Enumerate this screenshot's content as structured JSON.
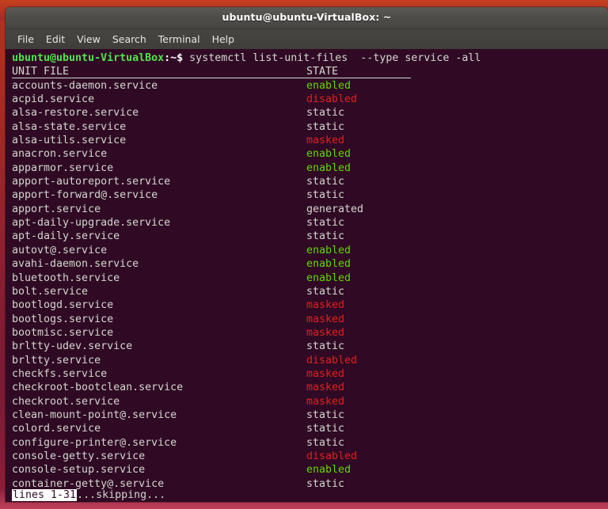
{
  "window": {
    "title": "ubuntu@ubuntu-VirtualBox: ~"
  },
  "menubar": {
    "items": [
      {
        "label": "File",
        "name": "menu-file"
      },
      {
        "label": "Edit",
        "name": "menu-edit"
      },
      {
        "label": "View",
        "name": "menu-view"
      },
      {
        "label": "Search",
        "name": "menu-search"
      },
      {
        "label": "Terminal",
        "name": "menu-terminal"
      },
      {
        "label": "Help",
        "name": "menu-help"
      }
    ]
  },
  "terminal": {
    "prompt_user": "ubuntu@ubuntu-VirtualBox",
    "prompt_tail": ":~$",
    "command": " systemctl list-unit-files  --type service -all",
    "header": {
      "unit_file": "UNIT FILE",
      "state": "STATE"
    },
    "rows": [
      {
        "unit": "accounts-daemon.service",
        "state": "enabled",
        "state_class": "st-enabled"
      },
      {
        "unit": "acpid.service",
        "state": "disabled",
        "state_class": "st-disabled"
      },
      {
        "unit": "alsa-restore.service",
        "state": "static",
        "state_class": "st-static"
      },
      {
        "unit": "alsa-state.service",
        "state": "static",
        "state_class": "st-static"
      },
      {
        "unit": "alsa-utils.service",
        "state": "masked",
        "state_class": "st-masked"
      },
      {
        "unit": "anacron.service",
        "state": "enabled",
        "state_class": "st-enabled"
      },
      {
        "unit": "apparmor.service",
        "state": "enabled",
        "state_class": "st-enabled"
      },
      {
        "unit": "apport-autoreport.service",
        "state": "static",
        "state_class": "st-static"
      },
      {
        "unit": "apport-forward@.service",
        "state": "static",
        "state_class": "st-static"
      },
      {
        "unit": "apport.service",
        "state": "generated",
        "state_class": "st-generated"
      },
      {
        "unit": "apt-daily-upgrade.service",
        "state": "static",
        "state_class": "st-static"
      },
      {
        "unit": "apt-daily.service",
        "state": "static",
        "state_class": "st-static"
      },
      {
        "unit": "autovt@.service",
        "state": "enabled",
        "state_class": "st-enabled"
      },
      {
        "unit": "avahi-daemon.service",
        "state": "enabled",
        "state_class": "st-enabled"
      },
      {
        "unit": "bluetooth.service",
        "state": "enabled",
        "state_class": "st-enabled"
      },
      {
        "unit": "bolt.service",
        "state": "static",
        "state_class": "st-static"
      },
      {
        "unit": "bootlogd.service",
        "state": "masked",
        "state_class": "st-masked"
      },
      {
        "unit": "bootlogs.service",
        "state": "masked",
        "state_class": "st-masked"
      },
      {
        "unit": "bootmisc.service",
        "state": "masked",
        "state_class": "st-masked"
      },
      {
        "unit": "brltty-udev.service",
        "state": "static",
        "state_class": "st-static"
      },
      {
        "unit": "brltty.service",
        "state": "disabled",
        "state_class": "st-disabled"
      },
      {
        "unit": "checkfs.service",
        "state": "masked",
        "state_class": "st-masked"
      },
      {
        "unit": "checkroot-bootclean.service",
        "state": "masked",
        "state_class": "st-masked"
      },
      {
        "unit": "checkroot.service",
        "state": "masked",
        "state_class": "st-masked"
      },
      {
        "unit": "clean-mount-point@.service",
        "state": "static",
        "state_class": "st-static"
      },
      {
        "unit": "colord.service",
        "state": "static",
        "state_class": "st-static"
      },
      {
        "unit": "configure-printer@.service",
        "state": "static",
        "state_class": "st-static"
      },
      {
        "unit": "console-getty.service",
        "state": "disabled",
        "state_class": "st-disabled"
      },
      {
        "unit": "console-setup.service",
        "state": "enabled",
        "state_class": "st-enabled"
      },
      {
        "unit": "container-getty@.service",
        "state": "static",
        "state_class": "st-static"
      }
    ],
    "status": {
      "highlight": "lines 1-31",
      "rest": "...skipping..."
    }
  },
  "colors": {
    "terminal_bg": "#300a24",
    "enabled": "#5fd700",
    "disabled": "#e02020",
    "masked": "#e02020",
    "default_fg": "#d3d7cf",
    "prompt_green": "#4ee44e",
    "titlebar": "#504e4b"
  }
}
